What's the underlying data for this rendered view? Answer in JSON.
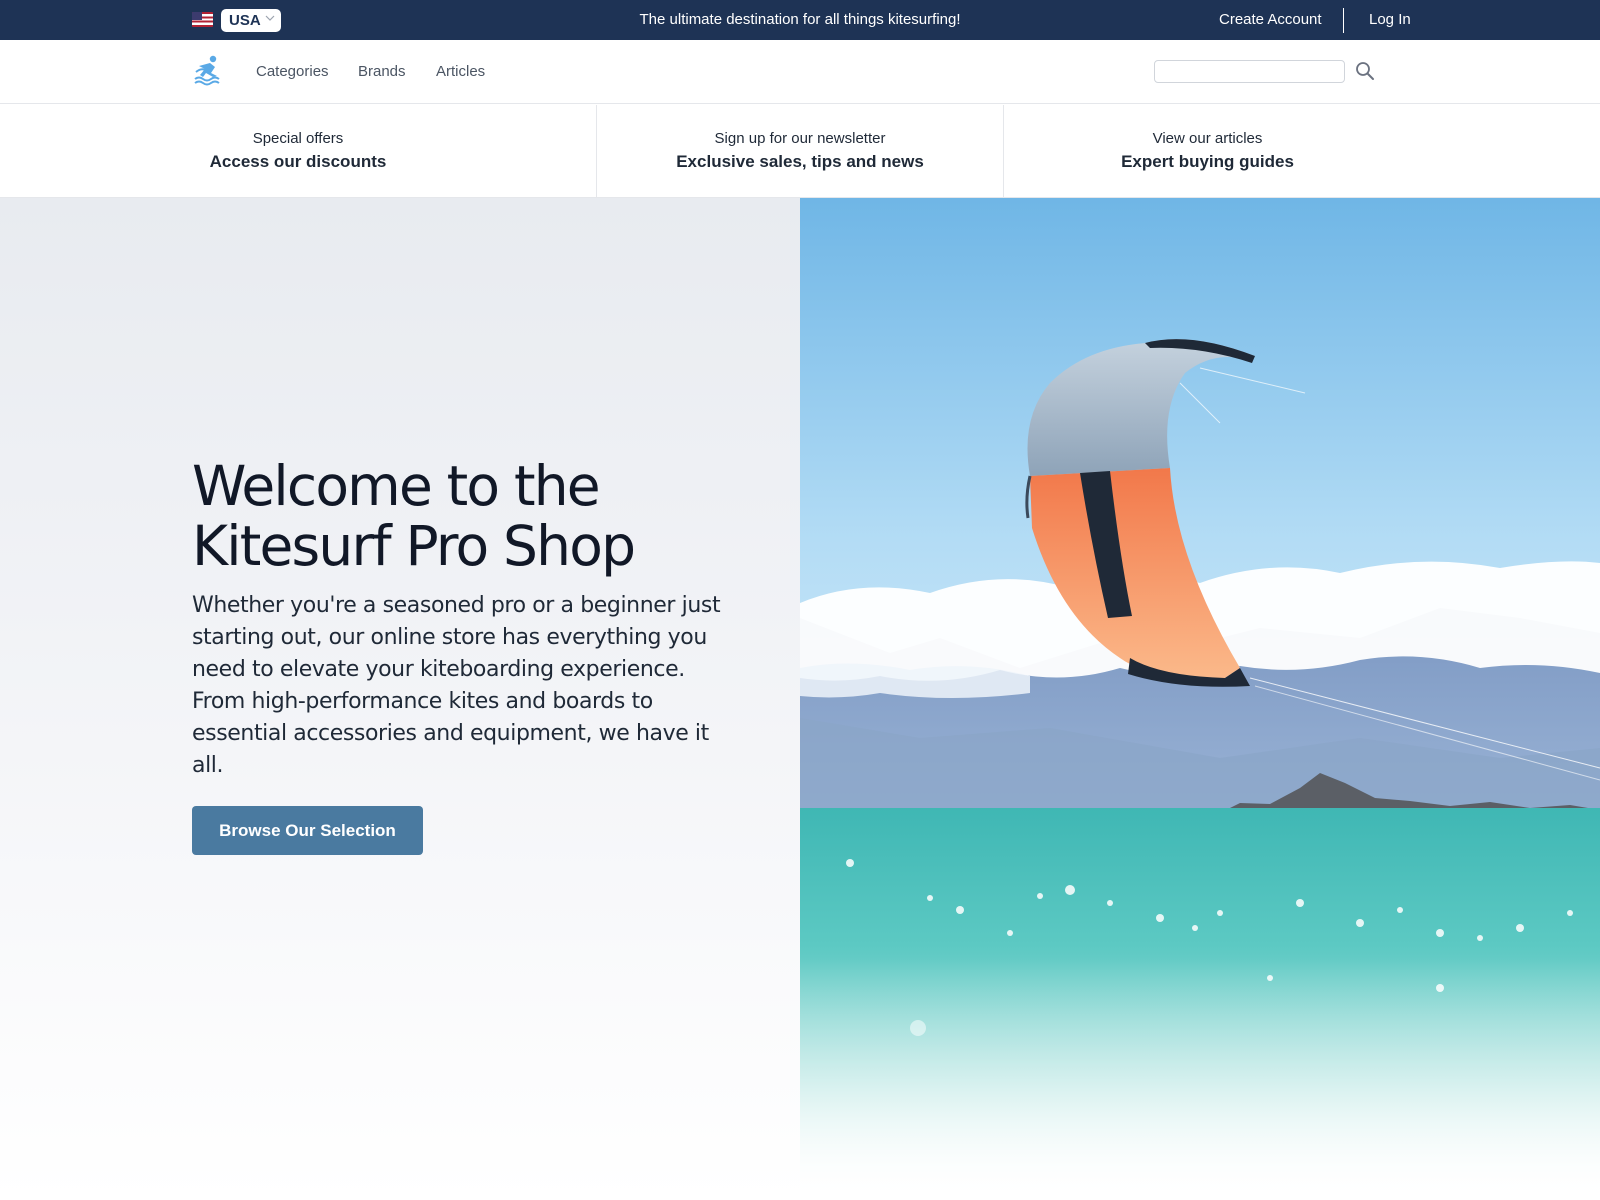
{
  "topbar": {
    "country": "USA",
    "announcement": "The ultimate destination for all things kitesurfing!",
    "create_account": "Create Account",
    "log_in": "Log In"
  },
  "nav": {
    "links": [
      "Categories",
      "Brands",
      "Articles"
    ],
    "search_value": ""
  },
  "promos": [
    {
      "sub": "Special offers",
      "title": "Access our discounts"
    },
    {
      "sub": "Sign up for our newsletter",
      "title": "Exclusive sales, tips and news"
    },
    {
      "sub": "View our articles",
      "title": "Expert buying guides"
    }
  ],
  "hero": {
    "title": "Welcome to the Kitesurf Pro Shop",
    "text": "Whether you're a seasoned pro or a beginner just starting out, our online store has everything you need to elevate your kiteboarding experience. From high-performance kites and boards to essential accessories and equipment, we have it all.",
    "cta": "Browse Our Selection"
  },
  "colors": {
    "topbar_bg": "#1e3355",
    "cta_bg": "#4a7aa0",
    "logo": "#5aa9e6",
    "kite_orange": "#f58a5c"
  },
  "icons": [
    "us-flag-icon",
    "chevron-down-icon",
    "surfer-logo-icon",
    "search-icon"
  ]
}
